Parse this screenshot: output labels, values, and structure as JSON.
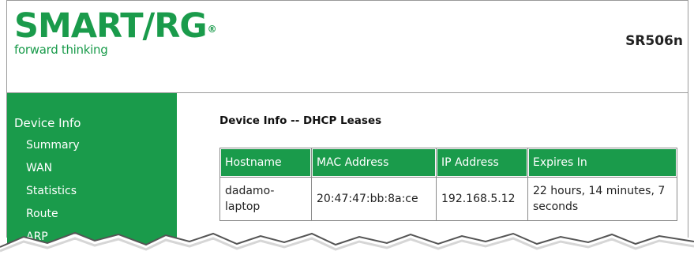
{
  "header": {
    "logo_text": "SMART/RG",
    "logo_mark": "®",
    "tagline": "forward thinking",
    "model": "SR506n"
  },
  "sidebar": {
    "heading": "Device Info",
    "items": [
      {
        "label": "Summary"
      },
      {
        "label": "WAN"
      },
      {
        "label": "Statistics"
      },
      {
        "label": "Route"
      },
      {
        "label": "ARP"
      }
    ]
  },
  "main": {
    "title": "Device Info -- DHCP Leases",
    "table": {
      "columns": [
        "Hostname",
        "MAC Address",
        "IP Address",
        "Expires In"
      ],
      "rows": [
        {
          "hostname": "dadamo-laptop",
          "mac": "20:47:47:bb:8a:ce",
          "ip": "192.168.5.12",
          "expires": "22 hours, 14 minutes, 7 seconds"
        }
      ]
    }
  },
  "colors": {
    "brand_green": "#1a9b4b"
  }
}
